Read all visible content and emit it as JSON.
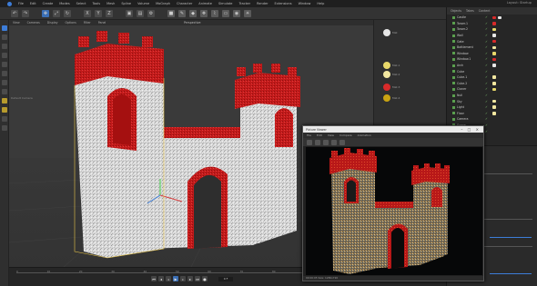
{
  "menubar": {
    "items": [
      "File",
      "Edit",
      "Create",
      "Modes",
      "Select",
      "Tools",
      "Mesh",
      "Spline",
      "Volume",
      "MoGraph",
      "Character",
      "Animate",
      "Simulate",
      "Tracker",
      "Render",
      "Extensions",
      "Window",
      "Help"
    ],
    "right_text": "Layout: Startup"
  },
  "viewport": {
    "menu": [
      "View",
      "Cameras",
      "Display",
      "Options",
      "Filter",
      "Panel"
    ],
    "title": "Perspective",
    "info": "Default Camera"
  },
  "palette": {
    "items": [
      {
        "label": "Mat",
        "color": "#e6e6e6"
      },
      {
        "label": "Mat.1",
        "color": "#e8d86a"
      },
      {
        "label": "Mat.2",
        "color": "#f2e7a0"
      },
      {
        "label": "Mat.3",
        "color": "#d82a2a"
      },
      {
        "label": "Mat.4",
        "color": "#c9a312"
      }
    ]
  },
  "objects": {
    "tabs": [
      "Objects",
      "Takes",
      "Content"
    ],
    "rows": [
      "Castle",
      "Tower.1",
      "Tower.2",
      "Wall",
      "Gate",
      "Battlement",
      "Window",
      "Window.1",
      "Arch",
      "Cube",
      "Cube.1",
      "Cube.2",
      "Cloner",
      "Null",
      "Sky",
      "Light",
      "Floor",
      "Camera",
      "Scene",
      "Render"
    ]
  },
  "attributes": {
    "labels": [
      "Attributes",
      "Mode",
      "Basic",
      "Coord",
      "Object"
    ]
  },
  "timeline": {
    "ticks": [
      "0",
      "10",
      "20",
      "30",
      "40",
      "50",
      "60",
      "70",
      "80",
      "90"
    ],
    "frame": "0 F"
  },
  "render_window": {
    "title": "Picture Viewer",
    "menu": [
      "File",
      "Edit",
      "View",
      "Compare",
      "Animation"
    ],
    "status": "00:00:05 Size: 1280x720"
  }
}
